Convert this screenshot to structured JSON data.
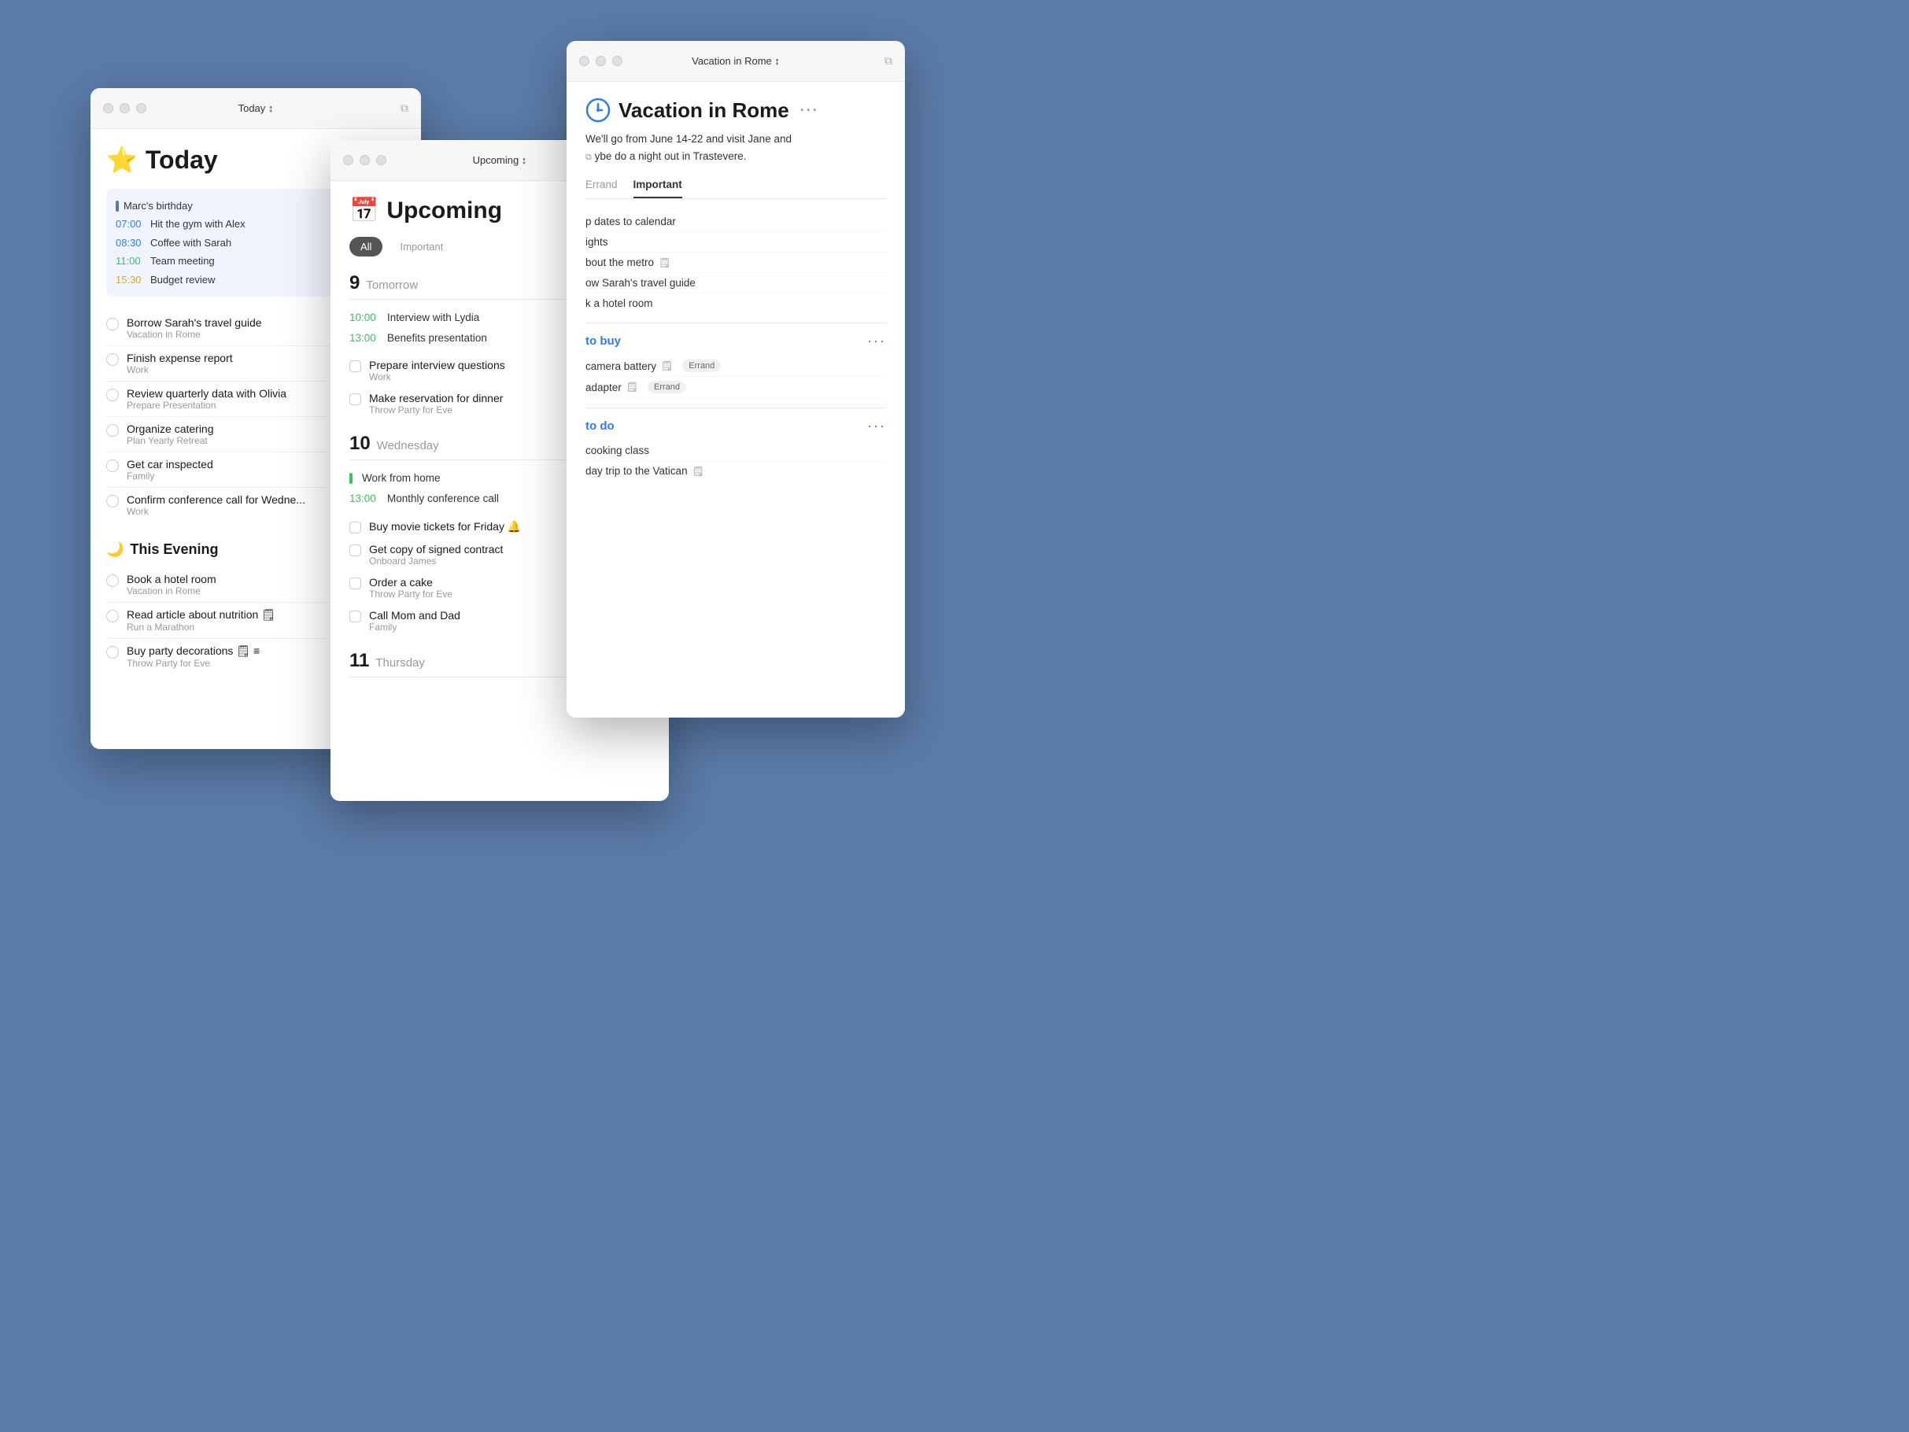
{
  "background": "#5b7ba8",
  "today_window": {
    "title": "Today ↕",
    "heading": "Today",
    "star": "⭐",
    "schedule": [
      {
        "type": "birthday",
        "text": "Marc's birthday"
      },
      {
        "time": "07:00",
        "text": "Hit the gym with Alex",
        "color": "blue"
      },
      {
        "time": "08:30",
        "text": "Coffee with Sarah",
        "color": "blue"
      },
      {
        "time": "11:00",
        "text": "Team meeting",
        "color": "green"
      },
      {
        "time": "15:30",
        "text": "Budget review",
        "color": "yellow"
      }
    ],
    "tasks": [
      {
        "name": "Borrow Sarah's travel guide",
        "subtitle": "Vacation in Rome"
      },
      {
        "name": "Finish expense report",
        "subtitle": "Work"
      },
      {
        "name": "Review quarterly data with Olivia",
        "subtitle": "Prepare Presentation"
      },
      {
        "name": "Organize catering",
        "subtitle": "Plan Yearly Retreat"
      },
      {
        "name": "Get car inspected",
        "subtitle": "Family"
      },
      {
        "name": "Confirm conference call for Wedne...",
        "subtitle": "Work"
      }
    ],
    "evening_heading": "This Evening",
    "evening_tasks": [
      {
        "name": "Book a hotel room",
        "subtitle": "Vacation in Rome"
      },
      {
        "name": "Read article about nutrition 🗒",
        "subtitle": "Run a Marathon"
      },
      {
        "name": "Buy party decorations 🗒 ≡",
        "subtitle": "Throw Party for Eve"
      }
    ]
  },
  "upcoming_window": {
    "title": "Upcoming ↕",
    "heading": "Upcoming",
    "calendar_emoji": "📅",
    "filters": [
      "All",
      "Important"
    ],
    "active_filter": "All",
    "days": [
      {
        "number": "9",
        "name": "Tomorrow",
        "timed_events": [
          {
            "time": "10:00",
            "text": "Interview with Lydia"
          },
          {
            "time": "13:00",
            "text": "Benefits presentation"
          }
        ],
        "tasks": [
          {
            "name": "Prepare interview questions",
            "subtitle": "Work"
          },
          {
            "name": "Make reservation for dinner",
            "subtitle": "Throw Party for Eve"
          }
        ]
      },
      {
        "number": "10",
        "name": "Wednesday",
        "timed_events": [
          {
            "time": "",
            "text": "Work from home",
            "color": "green",
            "bar": true
          },
          {
            "time": "13:00",
            "text": "Monthly conference call"
          }
        ],
        "tasks": [
          {
            "name": "Buy movie tickets for Friday 🔔",
            "subtitle": ""
          },
          {
            "name": "Get copy of signed contract",
            "subtitle": "Onboard James"
          },
          {
            "name": "Order a cake",
            "subtitle": "Throw Party for Eve"
          },
          {
            "name": "Call Mom and Dad",
            "subtitle": "Family"
          }
        ]
      },
      {
        "number": "11",
        "name": "Thursday",
        "timed_events": [],
        "tasks": []
      }
    ]
  },
  "vacation_window": {
    "title": "Vacation in Rome ↕",
    "heading": "Vacation in Rome",
    "more": "···",
    "description": "We'll go from June 14-22 and visit Jane and maybe do a night out in Trastevere.",
    "tabs": [
      "Errand",
      "Important"
    ],
    "sections": [
      {
        "id": "to_buy",
        "label": "to buy",
        "items": [
          {
            "text": "camera battery",
            "note": true,
            "tag": "Errand"
          },
          {
            "text": "adapter",
            "note": true,
            "tag": "Errand"
          }
        ]
      },
      {
        "id": "to_do",
        "label": "to do",
        "items": [
          {
            "text": "cooking class",
            "note": false,
            "tag": ""
          },
          {
            "text": "day trip to the Vatican",
            "note": true,
            "tag": ""
          }
        ]
      }
    ],
    "todo_tasks": [
      {
        "text": "p dates to calendar"
      },
      {
        "text": "ights"
      },
      {
        "text": "bout the metro 🗒"
      },
      {
        "text": "ow Sarah's travel guide"
      },
      {
        "text": "k a hotel room"
      }
    ]
  }
}
